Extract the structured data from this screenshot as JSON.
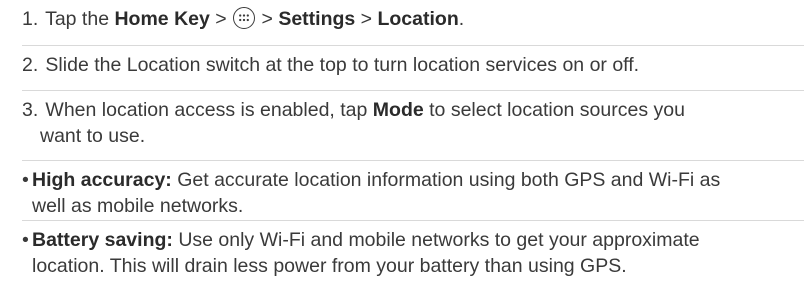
{
  "step1": {
    "num": "1.",
    "tap": "Tap the",
    "home_key": "Home Key",
    "sep1": ">",
    "sep2": ">",
    "settings": "Settings",
    "sep3": ">",
    "location": "Location",
    "end": ".",
    "icon": "apps-icon"
  },
  "step2": {
    "num": "2.",
    "text": "Slide the Location switch at the top to turn location services on or off."
  },
  "step3": {
    "num": "3.",
    "text_a": "When location access is enabled, tap",
    "mode": "Mode",
    "text_b": "to select location sources you",
    "text_c": "want to use."
  },
  "bullet1": {
    "marker": "•",
    "label": "High accuracy:",
    "text_a": "Get accurate location information using both GPS and Wi-Fi as",
    "text_b": "well as mobile networks."
  },
  "bullet2": {
    "marker": "•",
    "label": "Battery saving:",
    "text_a": "Use only Wi-Fi and mobile networks to get your approximate",
    "text_b": "location. This will drain less power from your battery than using GPS."
  }
}
